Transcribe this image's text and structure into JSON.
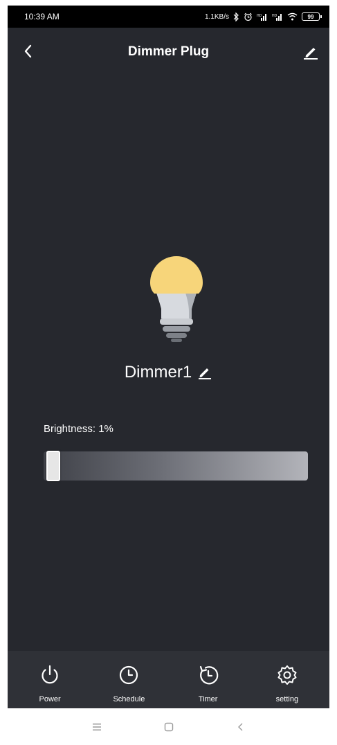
{
  "status_bar": {
    "time": "10:39 AM",
    "network_speed": "1.1KB/s",
    "battery_level": "99",
    "icons": [
      "bluetooth-icon",
      "alarm-icon",
      "signal-icon",
      "signal-icon",
      "wifi-icon",
      "battery-icon"
    ]
  },
  "header": {
    "title": "Dimmer Plug",
    "back_icon": "chevron-left-icon",
    "edit_icon": "edit-icon"
  },
  "device": {
    "name": "Dimmer1",
    "bulb_color": "#f7d57a"
  },
  "brightness": {
    "label": "Brightness: 1%",
    "value": 0.01
  },
  "tabs": [
    {
      "label": "Power",
      "icon": "power-icon"
    },
    {
      "label": "Schedule",
      "icon": "clock-icon"
    },
    {
      "label": "Timer",
      "icon": "timer-icon"
    },
    {
      "label": "setting",
      "icon": "gear-icon"
    }
  ],
  "colors": {
    "background": "#26282e",
    "bottom_bar": "#2f3137",
    "accent_bulb": "#f7d57a"
  }
}
